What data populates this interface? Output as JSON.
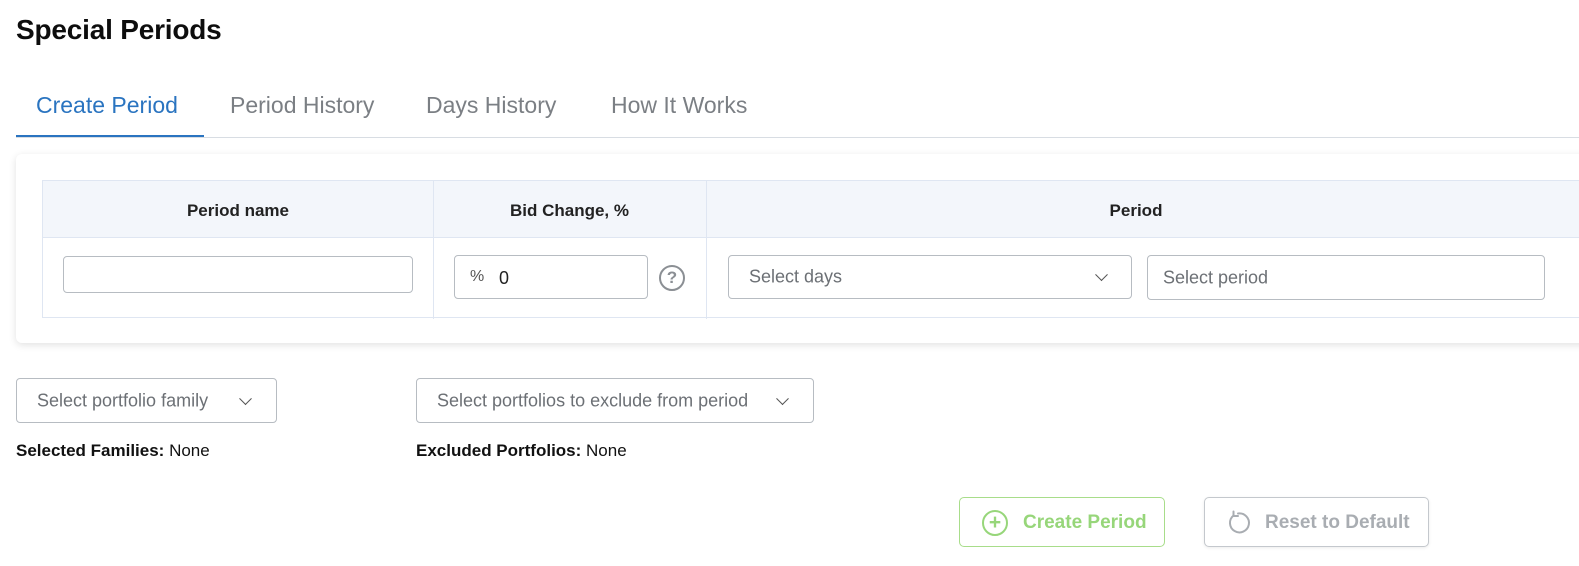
{
  "page": {
    "title": "Special Periods"
  },
  "tabs": [
    {
      "label": "Create Period",
      "active": true
    },
    {
      "label": "Period History",
      "active": false
    },
    {
      "label": "Days History",
      "active": false
    },
    {
      "label": "How It Works",
      "active": false
    }
  ],
  "table": {
    "headers": {
      "period_name": "Period name",
      "bid_change": "Bid Change, %",
      "period": "Period"
    },
    "period_name_value": "",
    "bid_change": {
      "prefix": "%",
      "value": "0"
    },
    "days_select": {
      "placeholder": "Select days"
    },
    "period_select": {
      "placeholder": "Select period"
    }
  },
  "filters": {
    "family_select": {
      "placeholder": "Select portfolio family"
    },
    "exclude_select": {
      "placeholder": "Select portfolios to exclude from period"
    },
    "selected_families": {
      "label": "Selected Families:",
      "value": "None"
    },
    "excluded_portfolios": {
      "label": "Excluded Portfolios:",
      "value": "None"
    }
  },
  "actions": {
    "create_label": "Create Period",
    "reset_label": "Reset to Default"
  },
  "colors": {
    "accent": "#2a74c0",
    "create_green": "#97d67a",
    "header_bg": "#f3f6fb"
  },
  "icons": {
    "help": "help-circle-icon",
    "create": "plus-circle-icon",
    "reset": "reset-icon",
    "dropdown": "chevron-down-icon"
  }
}
